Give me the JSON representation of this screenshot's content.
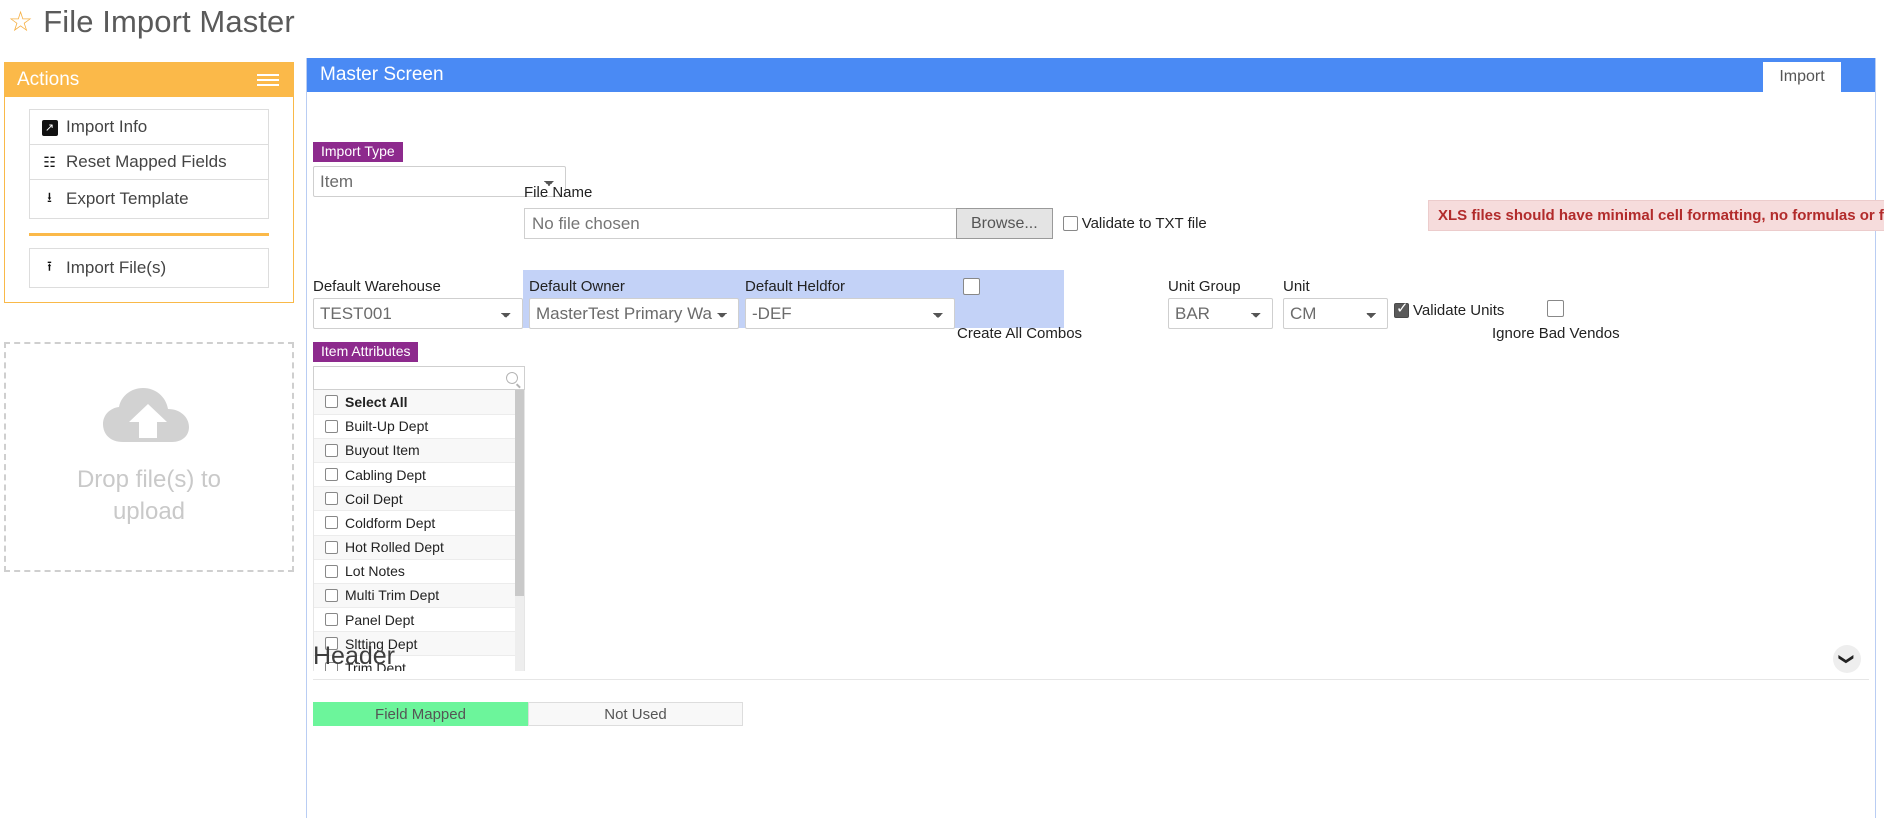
{
  "page": {
    "title": "File Import Master",
    "star_icon": "star-outline-icon"
  },
  "actions": {
    "header": "Actions",
    "menu_icon": "hamburger-icon",
    "items": [
      {
        "label": "Import Info",
        "icon": "external-link-icon"
      },
      {
        "label": "Reset Mapped Fields",
        "icon": "sitemap-icon"
      },
      {
        "label": "Export Template",
        "icon": "download-icon"
      }
    ],
    "primary": {
      "label": "Import File(s)",
      "icon": "upload-icon"
    }
  },
  "dropzone": {
    "icon": "cloud-upload-icon",
    "line1": "Drop file(s) to",
    "line2": "upload"
  },
  "main": {
    "header": "Master Screen",
    "tab": "Import"
  },
  "form": {
    "import_type": {
      "tag": "Import Type",
      "value": "Item",
      "options": [
        "Item"
      ]
    },
    "file_name": {
      "label": "File Name",
      "placeholder": "No file chosen",
      "value": "",
      "browse_label": "Browse..."
    },
    "validate_txt": {
      "label": "Validate to TXT file",
      "checked": false
    },
    "warning": "XLS files should have minimal cell formatting, no formulas or functions",
    "default_warehouse": {
      "label": "Default Warehouse",
      "value": "TEST001",
      "options": [
        "TEST001"
      ]
    },
    "default_owner": {
      "label": "Default Owner",
      "value": "MasterTest Primary Warehouse",
      "options": [
        "MasterTest Primary Warehouse"
      ]
    },
    "default_heldfor": {
      "label": "Default Heldfor",
      "value": "-DEF",
      "options": [
        "-DEF"
      ]
    },
    "create_all_combos": {
      "label": "Create All Combos",
      "checked": false
    },
    "unit_group": {
      "label": "Unit Group",
      "value": "BAR",
      "options": [
        "BAR"
      ]
    },
    "unit": {
      "label": "Unit",
      "value": "CM",
      "options": [
        "CM"
      ]
    },
    "validate_units": {
      "label": "Validate Units",
      "checked": true
    },
    "ignore_bad_vendors": {
      "label": "Ignore Bad Vendos",
      "checked": false
    }
  },
  "item_attributes": {
    "tag": "Item Attributes",
    "search_placeholder": "",
    "search_value": "",
    "search_icon": "search-icon",
    "rows": [
      {
        "label": "Select All",
        "checked": false,
        "bold": true
      },
      {
        "label": "Built-Up Dept",
        "checked": false,
        "bold": false
      },
      {
        "label": "Buyout Item",
        "checked": false,
        "bold": false
      },
      {
        "label": "Cabling Dept",
        "checked": false,
        "bold": false
      },
      {
        "label": "Coil Dept",
        "checked": false,
        "bold": false
      },
      {
        "label": "Coldform Dept",
        "checked": false,
        "bold": false
      },
      {
        "label": "Hot Rolled Dept",
        "checked": false,
        "bold": false
      },
      {
        "label": "Lot Notes",
        "checked": false,
        "bold": false
      },
      {
        "label": "Multi Trim Dept",
        "checked": false,
        "bold": false
      },
      {
        "label": "Panel Dept",
        "checked": false,
        "bold": false
      },
      {
        "label": "Sltting Dept",
        "checked": false,
        "bold": false
      },
      {
        "label": "Trim Dept",
        "checked": false,
        "bold": false
      }
    ]
  },
  "header_section": {
    "title": "Header",
    "collapse_icon": "chevron-down-icon",
    "legend": [
      {
        "label": "Field Mapped",
        "state": "mapped"
      },
      {
        "label": "Not Used",
        "state": "not-used"
      }
    ]
  },
  "colors": {
    "accent_orange": "#fbb949",
    "accent_blue": "#4a8af4",
    "tag_purple": "#8d2a8d",
    "warning_bg": "#f6dcdc",
    "warning_text": "#b22b2b",
    "mapped_green": "#6cf59b",
    "highlight_blue": "#c3d2f7"
  }
}
